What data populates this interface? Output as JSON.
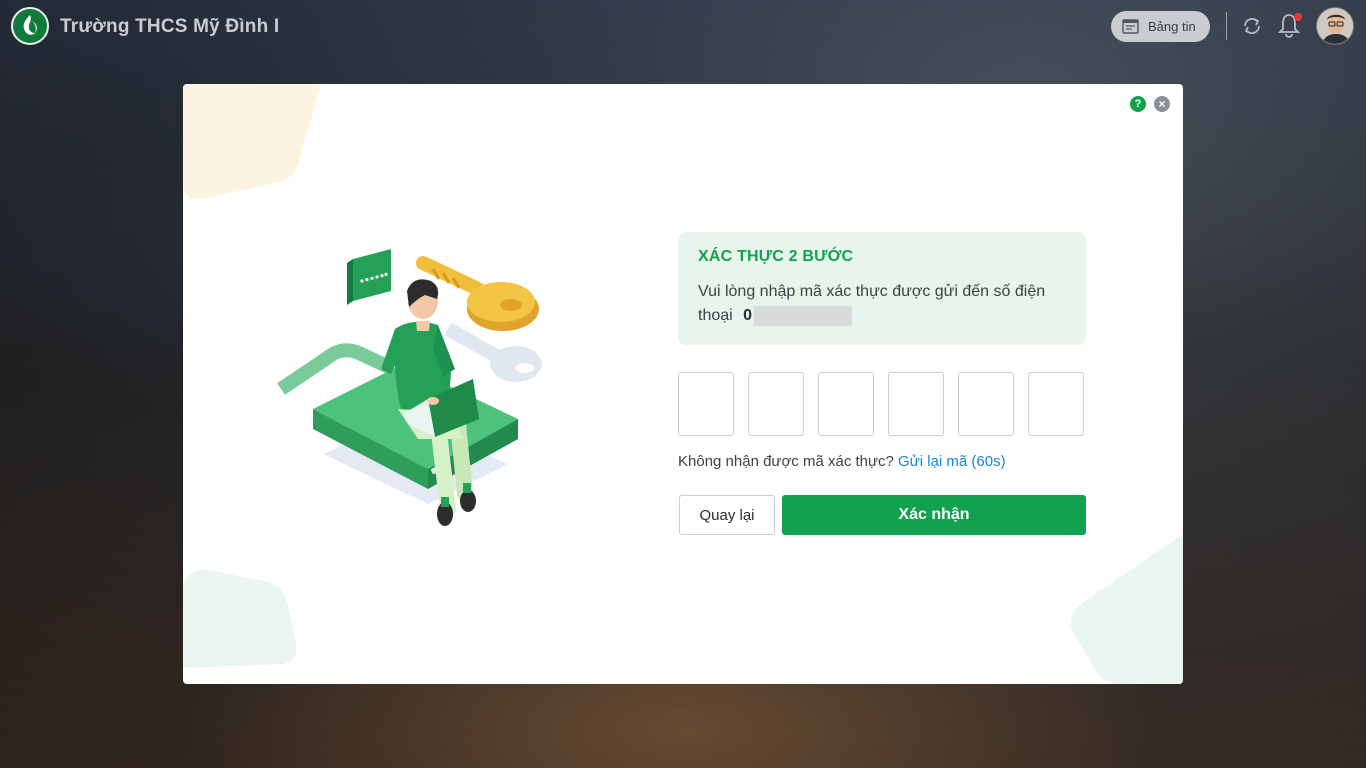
{
  "header": {
    "school_name": "Trường THCS Mỹ Đình I",
    "news_label": "Bảng tin",
    "icons": [
      "school-logo-icon",
      "newspaper-icon",
      "sync-icon",
      "bell-icon",
      "avatar"
    ]
  },
  "dialog": {
    "title": "XÁC THỰC 2 BƯỚC",
    "message": "Vui lòng nhập mã xác thực được gửi đến số điện thoại",
    "phone_prefix": "0",
    "otp_values": [
      "",
      "",
      "",
      "",
      "",
      ""
    ],
    "resend_prompt": "Không nhận được mã xác thực?",
    "resend_link": "Gửi lại mã (60s)",
    "back_label": "Quay lại",
    "confirm_label": "Xác nhận",
    "help_label": "?",
    "close_label": "×"
  },
  "colors": {
    "accent": "#12a24f",
    "info_bg": "#e7f5ec",
    "link": "#1686d9"
  }
}
